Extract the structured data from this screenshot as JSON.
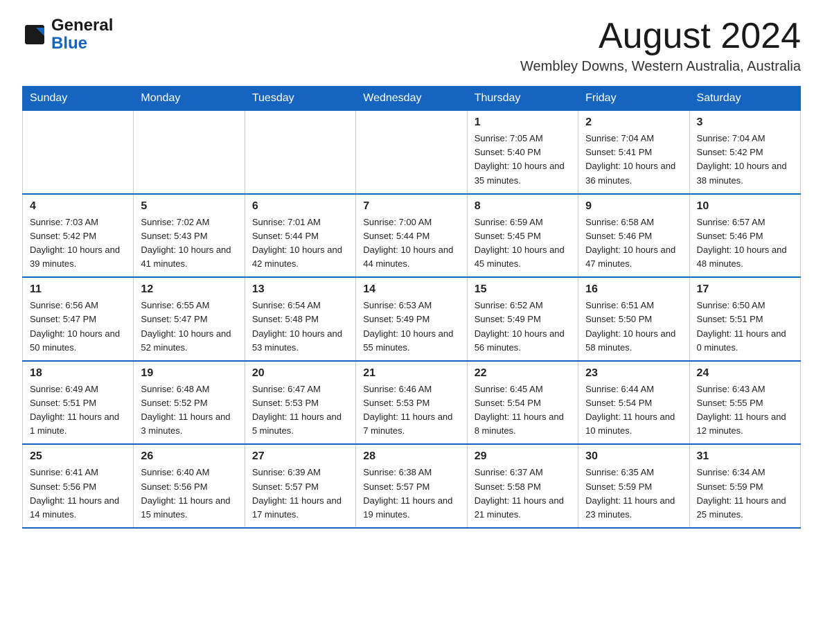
{
  "header": {
    "logo_general": "General",
    "logo_blue": "Blue",
    "month_year": "August 2024",
    "location": "Wembley Downs, Western Australia, Australia"
  },
  "days_of_week": [
    "Sunday",
    "Monday",
    "Tuesday",
    "Wednesday",
    "Thursday",
    "Friday",
    "Saturday"
  ],
  "weeks": [
    [
      {
        "day": "",
        "info": ""
      },
      {
        "day": "",
        "info": ""
      },
      {
        "day": "",
        "info": ""
      },
      {
        "day": "",
        "info": ""
      },
      {
        "day": "1",
        "info": "Sunrise: 7:05 AM\nSunset: 5:40 PM\nDaylight: 10 hours and 35 minutes."
      },
      {
        "day": "2",
        "info": "Sunrise: 7:04 AM\nSunset: 5:41 PM\nDaylight: 10 hours and 36 minutes."
      },
      {
        "day": "3",
        "info": "Sunrise: 7:04 AM\nSunset: 5:42 PM\nDaylight: 10 hours and 38 minutes."
      }
    ],
    [
      {
        "day": "4",
        "info": "Sunrise: 7:03 AM\nSunset: 5:42 PM\nDaylight: 10 hours and 39 minutes."
      },
      {
        "day": "5",
        "info": "Sunrise: 7:02 AM\nSunset: 5:43 PM\nDaylight: 10 hours and 41 minutes."
      },
      {
        "day": "6",
        "info": "Sunrise: 7:01 AM\nSunset: 5:44 PM\nDaylight: 10 hours and 42 minutes."
      },
      {
        "day": "7",
        "info": "Sunrise: 7:00 AM\nSunset: 5:44 PM\nDaylight: 10 hours and 44 minutes."
      },
      {
        "day": "8",
        "info": "Sunrise: 6:59 AM\nSunset: 5:45 PM\nDaylight: 10 hours and 45 minutes."
      },
      {
        "day": "9",
        "info": "Sunrise: 6:58 AM\nSunset: 5:46 PM\nDaylight: 10 hours and 47 minutes."
      },
      {
        "day": "10",
        "info": "Sunrise: 6:57 AM\nSunset: 5:46 PM\nDaylight: 10 hours and 48 minutes."
      }
    ],
    [
      {
        "day": "11",
        "info": "Sunrise: 6:56 AM\nSunset: 5:47 PM\nDaylight: 10 hours and 50 minutes."
      },
      {
        "day": "12",
        "info": "Sunrise: 6:55 AM\nSunset: 5:47 PM\nDaylight: 10 hours and 52 minutes."
      },
      {
        "day": "13",
        "info": "Sunrise: 6:54 AM\nSunset: 5:48 PM\nDaylight: 10 hours and 53 minutes."
      },
      {
        "day": "14",
        "info": "Sunrise: 6:53 AM\nSunset: 5:49 PM\nDaylight: 10 hours and 55 minutes."
      },
      {
        "day": "15",
        "info": "Sunrise: 6:52 AM\nSunset: 5:49 PM\nDaylight: 10 hours and 56 minutes."
      },
      {
        "day": "16",
        "info": "Sunrise: 6:51 AM\nSunset: 5:50 PM\nDaylight: 10 hours and 58 minutes."
      },
      {
        "day": "17",
        "info": "Sunrise: 6:50 AM\nSunset: 5:51 PM\nDaylight: 11 hours and 0 minutes."
      }
    ],
    [
      {
        "day": "18",
        "info": "Sunrise: 6:49 AM\nSunset: 5:51 PM\nDaylight: 11 hours and 1 minute."
      },
      {
        "day": "19",
        "info": "Sunrise: 6:48 AM\nSunset: 5:52 PM\nDaylight: 11 hours and 3 minutes."
      },
      {
        "day": "20",
        "info": "Sunrise: 6:47 AM\nSunset: 5:53 PM\nDaylight: 11 hours and 5 minutes."
      },
      {
        "day": "21",
        "info": "Sunrise: 6:46 AM\nSunset: 5:53 PM\nDaylight: 11 hours and 7 minutes."
      },
      {
        "day": "22",
        "info": "Sunrise: 6:45 AM\nSunset: 5:54 PM\nDaylight: 11 hours and 8 minutes."
      },
      {
        "day": "23",
        "info": "Sunrise: 6:44 AM\nSunset: 5:54 PM\nDaylight: 11 hours and 10 minutes."
      },
      {
        "day": "24",
        "info": "Sunrise: 6:43 AM\nSunset: 5:55 PM\nDaylight: 11 hours and 12 minutes."
      }
    ],
    [
      {
        "day": "25",
        "info": "Sunrise: 6:41 AM\nSunset: 5:56 PM\nDaylight: 11 hours and 14 minutes."
      },
      {
        "day": "26",
        "info": "Sunrise: 6:40 AM\nSunset: 5:56 PM\nDaylight: 11 hours and 15 minutes."
      },
      {
        "day": "27",
        "info": "Sunrise: 6:39 AM\nSunset: 5:57 PM\nDaylight: 11 hours and 17 minutes."
      },
      {
        "day": "28",
        "info": "Sunrise: 6:38 AM\nSunset: 5:57 PM\nDaylight: 11 hours and 19 minutes."
      },
      {
        "day": "29",
        "info": "Sunrise: 6:37 AM\nSunset: 5:58 PM\nDaylight: 11 hours and 21 minutes."
      },
      {
        "day": "30",
        "info": "Sunrise: 6:35 AM\nSunset: 5:59 PM\nDaylight: 11 hours and 23 minutes."
      },
      {
        "day": "31",
        "info": "Sunrise: 6:34 AM\nSunset: 5:59 PM\nDaylight: 11 hours and 25 minutes."
      }
    ]
  ]
}
